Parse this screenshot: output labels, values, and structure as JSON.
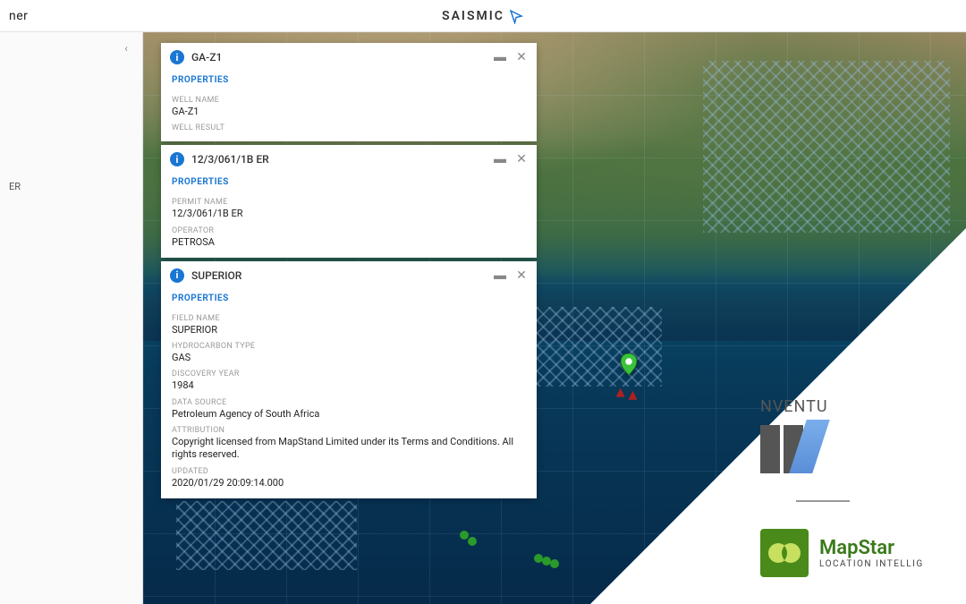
{
  "header": {
    "left_text": "ner",
    "brand": "SAISMIC"
  },
  "sidebar": {
    "partial_text": "ER"
  },
  "popups": [
    {
      "title": "GA-Z1",
      "section": "PROPERTIES",
      "props": [
        {
          "label": "WELL NAME",
          "value": "GA-Z1"
        },
        {
          "label": "WELL RESULT",
          "value": ""
        }
      ]
    },
    {
      "title": "12/3/061/1B ER",
      "section": "PROPERTIES",
      "props": [
        {
          "label": "PERMIT NAME",
          "value": "12/3/061/1B ER"
        },
        {
          "label": "OPERATOR",
          "value": "PETROSA"
        }
      ]
    },
    {
      "title": "SUPERIOR",
      "section": "PROPERTIES",
      "props": [
        {
          "label": "FIELD NAME",
          "value": "SUPERIOR"
        },
        {
          "label": "HYDROCARBON TYPE",
          "value": "GAS"
        },
        {
          "label": "DISCOVERY YEAR",
          "value": "1984"
        },
        {
          "label": "DATA SOURCE",
          "value": "Petroleum Agency of South Africa"
        },
        {
          "label": "ATTRIBUTION",
          "value": "Copyright licensed from MapStand Limited under its Terms and Conditions. All rights reserved."
        },
        {
          "label": "UPDATED",
          "value": "2020/01/29 20:09:14.000"
        }
      ]
    }
  ],
  "brands": {
    "nventures": "NVENTU",
    "mapstand_name": "MapStar",
    "mapstand_tag": "LOCATION INTELLIG"
  }
}
